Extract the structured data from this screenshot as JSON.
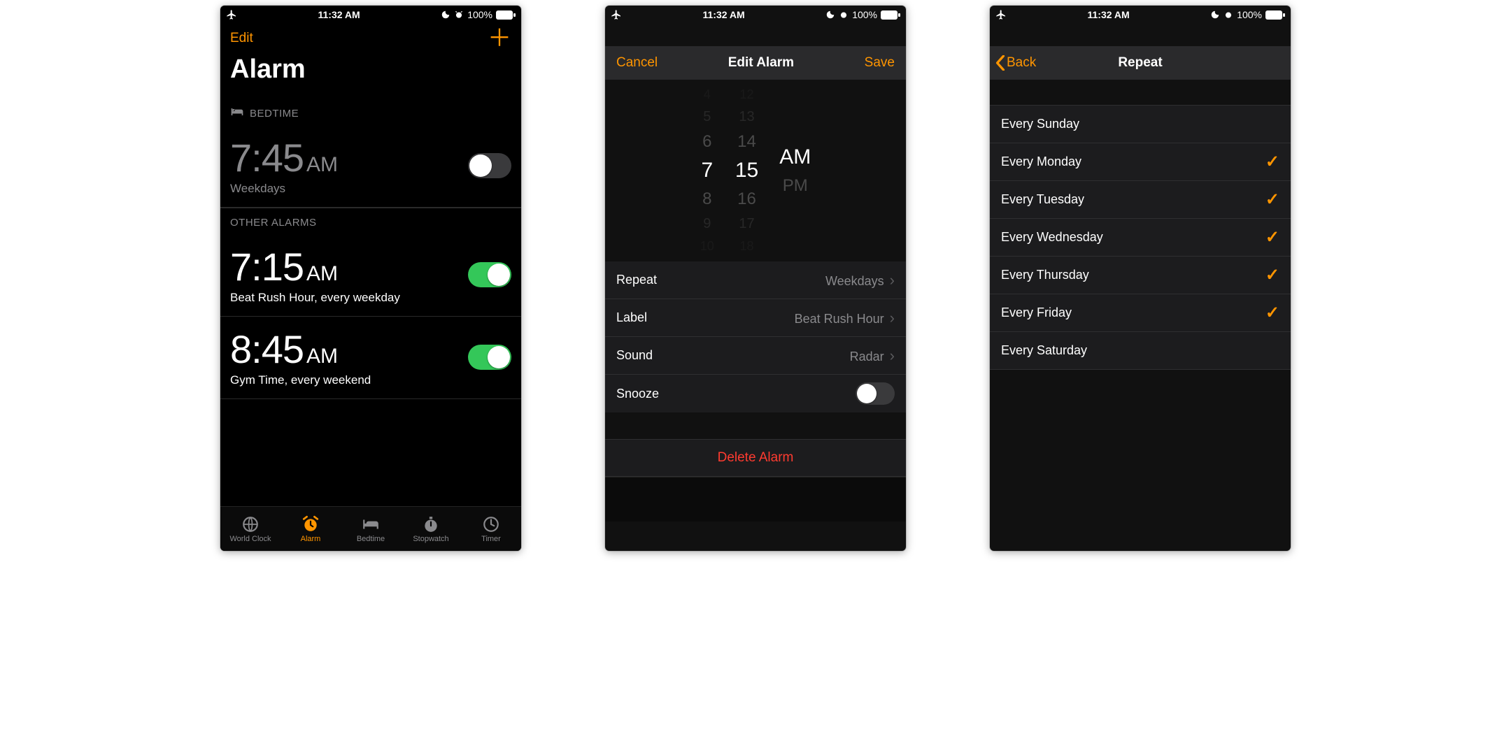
{
  "status": {
    "time": "11:32 AM",
    "battery": "100%"
  },
  "screen1": {
    "editLabel": "Edit",
    "title": "Alarm",
    "sectionBedtime": "BEDTIME",
    "sectionOther": "OTHER ALARMS",
    "bedtime": {
      "time": "7:45",
      "ampm": "AM",
      "sub": "Weekdays",
      "on": false
    },
    "alarms": [
      {
        "time": "7:15",
        "ampm": "AM",
        "sub": "Beat Rush Hour, every weekday",
        "on": true
      },
      {
        "time": "8:45",
        "ampm": "AM",
        "sub": "Gym Time, every weekend",
        "on": true
      }
    ],
    "tabs": [
      "World Clock",
      "Alarm",
      "Bedtime",
      "Stopwatch",
      "Timer"
    ]
  },
  "screen2": {
    "cancel": "Cancel",
    "save": "Save",
    "title": "Edit Alarm",
    "picker": {
      "hour": "7",
      "minute": "15",
      "ampm": [
        "AM",
        "PM"
      ]
    },
    "rows": {
      "repeat": {
        "label": "Repeat",
        "value": "Weekdays"
      },
      "label": {
        "label": "Label",
        "value": "Beat Rush Hour"
      },
      "sound": {
        "label": "Sound",
        "value": "Radar"
      },
      "snooze": {
        "label": "Snooze",
        "on": false
      }
    },
    "delete": "Delete Alarm"
  },
  "screen3": {
    "back": "Back",
    "title": "Repeat",
    "days": [
      {
        "label": "Every Sunday",
        "checked": false
      },
      {
        "label": "Every Monday",
        "checked": true
      },
      {
        "label": "Every Tuesday",
        "checked": true
      },
      {
        "label": "Every Wednesday",
        "checked": true
      },
      {
        "label": "Every Thursday",
        "checked": true
      },
      {
        "label": "Every Friday",
        "checked": true
      },
      {
        "label": "Every Saturday",
        "checked": false
      }
    ]
  },
  "colors": {
    "accent": "#ff9500",
    "green": "#34c759",
    "red": "#ff3b30"
  }
}
